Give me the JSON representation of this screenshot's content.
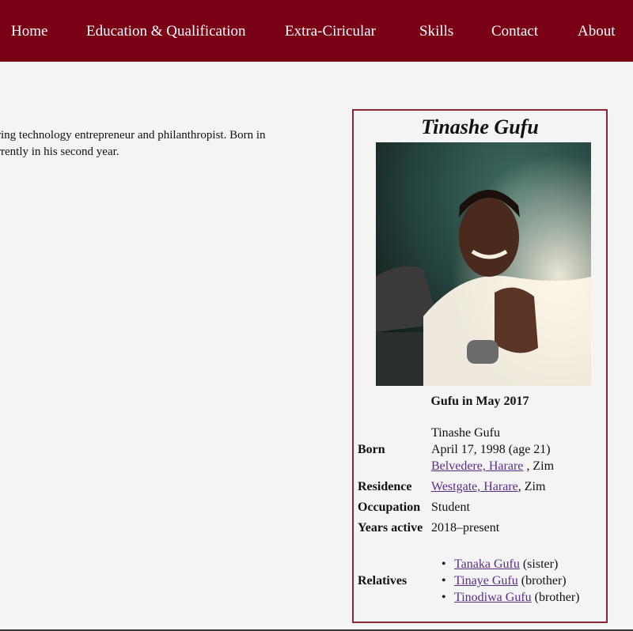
{
  "nav": {
    "items": [
      "Home",
      "Education & Qualification",
      "Extra-Ciricular",
      "Skills",
      "Contact",
      "About"
    ]
  },
  "intro": {
    "line1": "ring technology entrepreneur and philanthropist. Born in",
    "line2": "rrently in his second year."
  },
  "infobox": {
    "name": "Tinashe Gufu",
    "caption": "Gufu in May 2017",
    "born_label": "Born",
    "born_name": "Tinashe Gufu",
    "born_date": "April 17, 1998 (age 21)",
    "born_place_link": "Belvedere, Harare",
    "born_place_suffix": " , Zim",
    "residence_label": "Residence",
    "residence_link": "Westgate, Harare",
    "residence_suffix": ", Zim",
    "occupation_label": "Occupation",
    "occupation_value": "Student",
    "years_label": "Years active",
    "years_value": "2018–present",
    "relatives_label": "Relatives",
    "relatives": [
      {
        "name": "Tanaka Gufu",
        "relation": " (sister)"
      },
      {
        "name": "Tinaye Gufu",
        "relation": " (brother)"
      },
      {
        "name": "Tinodiwa Gufu",
        "relation": " (brother)"
      }
    ]
  },
  "colors": {
    "navbar": "#7a0015",
    "border": "#8a2535",
    "link": "#5a2d8a",
    "background": "#f4f4f4"
  }
}
